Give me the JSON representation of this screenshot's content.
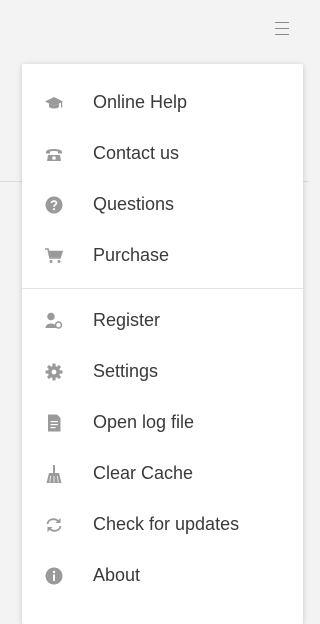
{
  "window": {
    "menu_button_icon": "hamburger-icon"
  },
  "menu": {
    "groups": [
      {
        "items": [
          {
            "label": "Online Help",
            "icon": "graduation-cap-icon"
          },
          {
            "label": "Contact us",
            "icon": "telephone-icon"
          },
          {
            "label": "Questions",
            "icon": "question-circle-icon"
          },
          {
            "label": "Purchase",
            "icon": "shopping-cart-icon"
          }
        ]
      },
      {
        "items": [
          {
            "label": "Register",
            "icon": "user-key-icon"
          },
          {
            "label": "Settings",
            "icon": "gear-icon"
          },
          {
            "label": "Open log file",
            "icon": "document-icon"
          },
          {
            "label": "Clear Cache",
            "icon": "broom-icon"
          },
          {
            "label": "Check for updates",
            "icon": "refresh-icon"
          },
          {
            "label": "About",
            "icon": "info-circle-icon"
          }
        ]
      }
    ]
  },
  "colors": {
    "icon": "#9a9a9a",
    "text": "#3a3a3a",
    "background": "#f3f3f3",
    "menu": "#ffffff"
  }
}
